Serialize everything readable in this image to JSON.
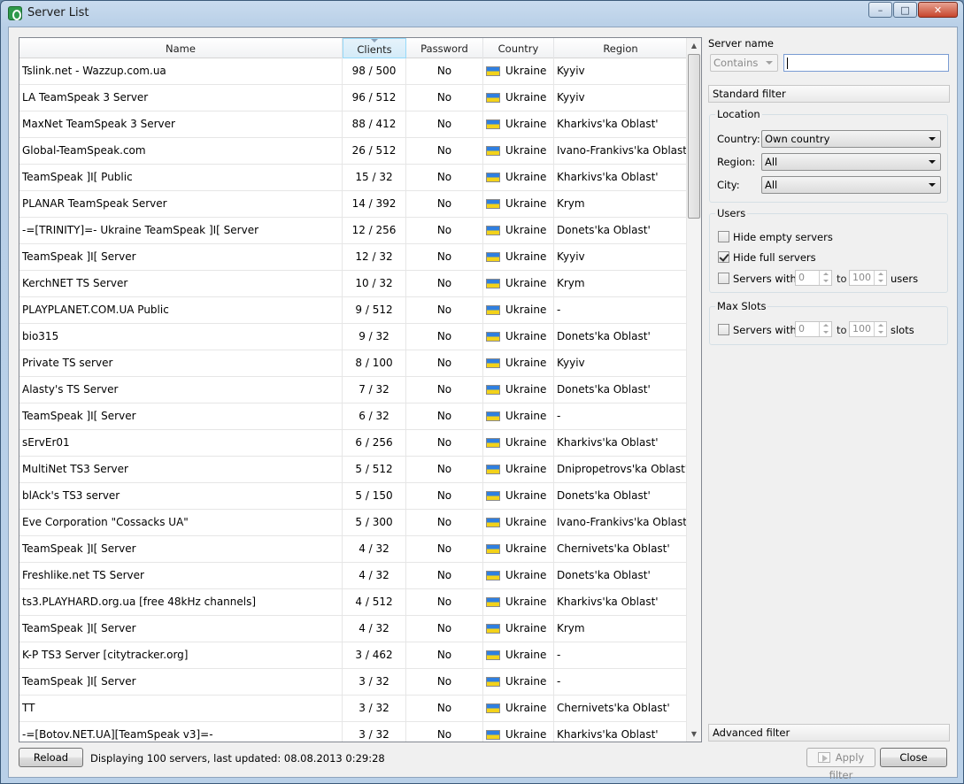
{
  "window": {
    "title": "Server List",
    "controls": {
      "minimize": "–",
      "maximize": "□",
      "close": "✕"
    }
  },
  "table": {
    "columns": [
      "Name",
      "Clients",
      "Password",
      "Country",
      "Region"
    ],
    "sorted_column": "Clients",
    "rows": [
      {
        "name": "Tslink.net - Wazzup.com.ua",
        "clients": "98 / 500",
        "password": "No",
        "country": "Ukraine",
        "region": "Kyyiv"
      },
      {
        "name": "LA TeamSpeak 3 Server",
        "clients": "96 / 512",
        "password": "No",
        "country": "Ukraine",
        "region": "Kyyiv"
      },
      {
        "name": "MaxNet TeamSpeak 3 Server",
        "clients": "88 / 412",
        "password": "No",
        "country": "Ukraine",
        "region": "Kharkivs'ka Oblast'"
      },
      {
        "name": "Global-TeamSpeak.com",
        "clients": "26 / 512",
        "password": "No",
        "country": "Ukraine",
        "region": "Ivano-Frankivs'ka Oblast'"
      },
      {
        "name": "TeamSpeak ]I[ Public",
        "clients": "15 / 32",
        "password": "No",
        "country": "Ukraine",
        "region": "Kharkivs'ka Oblast'"
      },
      {
        "name": "PLANAR TeamSpeak Server",
        "clients": "14 / 392",
        "password": "No",
        "country": "Ukraine",
        "region": "Krym"
      },
      {
        "name": "-=[TRINITY]=- Ukraine TeamSpeak ]I[ Server",
        "clients": "12 / 256",
        "password": "No",
        "country": "Ukraine",
        "region": "Donets'ka Oblast'"
      },
      {
        "name": "TeamSpeak ]I[ Server",
        "clients": "12 / 32",
        "password": "No",
        "country": "Ukraine",
        "region": "Kyyiv"
      },
      {
        "name": "KerchNET TS Server",
        "clients": "10 / 32",
        "password": "No",
        "country": "Ukraine",
        "region": "Krym"
      },
      {
        "name": "PLAYPLANET.COM.UA Public",
        "clients": "9 / 512",
        "password": "No",
        "country": "Ukraine",
        "region": "-"
      },
      {
        "name": "bio315",
        "clients": "9 / 32",
        "password": "No",
        "country": "Ukraine",
        "region": "Donets'ka Oblast'"
      },
      {
        "name": "Private TS server",
        "clients": "8 / 100",
        "password": "No",
        "country": "Ukraine",
        "region": "Kyyiv"
      },
      {
        "name": "Alasty's TS Server",
        "clients": "7 / 32",
        "password": "No",
        "country": "Ukraine",
        "region": "Donets'ka Oblast'"
      },
      {
        "name": "TeamSpeak ]I[ Server",
        "clients": "6 / 32",
        "password": "No",
        "country": "Ukraine",
        "region": "-"
      },
      {
        "name": "sErvEr01",
        "clients": "6 / 256",
        "password": "No",
        "country": "Ukraine",
        "region": "Kharkivs'ka Oblast'"
      },
      {
        "name": "MultiNet TS3 Server",
        "clients": "5 / 512",
        "password": "No",
        "country": "Ukraine",
        "region": "Dnipropetrovs'ka Oblast'"
      },
      {
        "name": "blAck's TS3 server",
        "clients": "5 / 150",
        "password": "No",
        "country": "Ukraine",
        "region": "Donets'ka Oblast'"
      },
      {
        "name": "Eve Corporation \"Cossacks UA\"",
        "clients": "5 / 300",
        "password": "No",
        "country": "Ukraine",
        "region": "Ivano-Frankivs'ka Oblast'"
      },
      {
        "name": "TeamSpeak ]I[ Server",
        "clients": "4 / 32",
        "password": "No",
        "country": "Ukraine",
        "region": "Chernivets'ka Oblast'"
      },
      {
        "name": "Freshlike.net  TS Server",
        "clients": "4 / 32",
        "password": "No",
        "country": "Ukraine",
        "region": "Donets'ka Oblast'"
      },
      {
        "name": "ts3.PLAYHARD.org.ua [free 48kHz channels]",
        "clients": "4 / 512",
        "password": "No",
        "country": "Ukraine",
        "region": "Kharkivs'ka Oblast'"
      },
      {
        "name": "TeamSpeak ]I[ Server",
        "clients": "4 / 32",
        "password": "No",
        "country": "Ukraine",
        "region": "Krym"
      },
      {
        "name": "K-P TS3 Server [citytracker.org]",
        "clients": "3 / 462",
        "password": "No",
        "country": "Ukraine",
        "region": "-"
      },
      {
        "name": "TeamSpeak ]I[ Server",
        "clients": "3 / 32",
        "password": "No",
        "country": "Ukraine",
        "region": "-"
      },
      {
        "name": "TT",
        "clients": "3 / 32",
        "password": "No",
        "country": "Ukraine",
        "region": "Chernivets'ka Oblast'"
      },
      {
        "name": "-=[Botov.NET.UA][TeamSpeak v3]=-",
        "clients": "3 / 32",
        "password": "No",
        "country": "Ukraine",
        "region": "Kharkivs'ka Oblast'"
      }
    ]
  },
  "filter": {
    "server_name_label": "Server name",
    "match_mode": "Contains",
    "search_value": "",
    "standard_filter_label": "Standard filter",
    "location": {
      "title": "Location",
      "country_label": "Country:",
      "country_value": "Own country",
      "region_label": "Region:",
      "region_value": "All",
      "city_label": "City:",
      "city_value": "All"
    },
    "users": {
      "title": "Users",
      "hide_empty_label": "Hide empty servers",
      "hide_empty_checked": false,
      "hide_full_label": "Hide full servers",
      "hide_full_checked": true,
      "servers_with_label": "Servers with",
      "servers_with_checked": false,
      "min": "0",
      "to_label": "to",
      "max": "100",
      "unit_label": "users"
    },
    "max_slots": {
      "title": "Max Slots",
      "servers_with_label": "Servers with",
      "servers_with_checked": false,
      "min": "0",
      "to_label": "to",
      "max": "100",
      "unit_label": "slots"
    },
    "advanced_filter_label": "Advanced filter"
  },
  "footer": {
    "reload_label": "Reload",
    "status": "Displaying 100 servers, last updated: 08.08.2013 0:29:28",
    "apply_label": "Apply filter",
    "close_label": "Close"
  }
}
